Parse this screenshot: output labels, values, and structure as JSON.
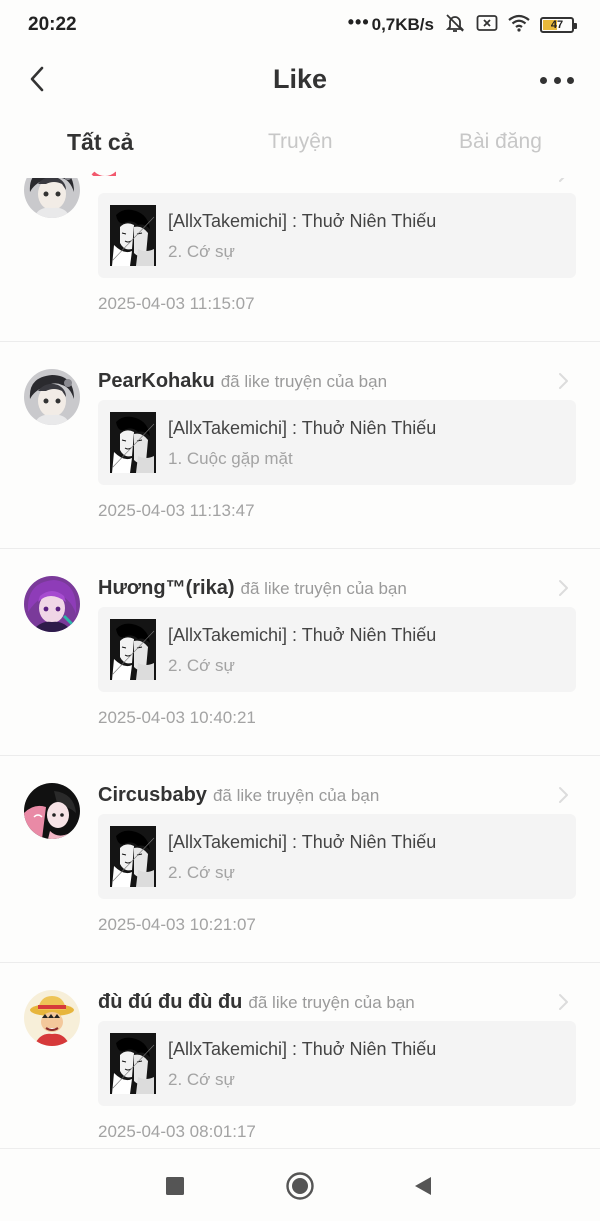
{
  "status_bar": {
    "time": "20:22",
    "dots": "•••",
    "net_speed": "0,7KB/s",
    "battery": "47",
    "icons": [
      "mute-icon",
      "sim-x-icon",
      "wifi-icon",
      "battery-icon"
    ]
  },
  "header": {
    "title": "Like",
    "back_icon": "chevron-left-icon",
    "more_icon": "more-dots-icon"
  },
  "tabs": [
    {
      "label": "Tất cả",
      "active": true
    },
    {
      "label": "Truyện",
      "active": false
    },
    {
      "label": "Bài đăng",
      "active": false
    }
  ],
  "colors": {
    "accent": "#f2596d",
    "card_bg": "#f4f4f4",
    "muted_text": "#a3a3a3"
  },
  "notifications": [
    {
      "username": "",
      "action": "",
      "avatar": "anime-dark-hair",
      "story_title": "[AllxTakemichi] : Thuở Niên Thiếu",
      "chapter": "2. Cớ sự",
      "time": "2025-04-03 11:15:07"
    },
    {
      "username": "PearKohaku",
      "action": "đã like truyện của bạn",
      "avatar": "anime-dark-hair",
      "story_title": "[AllxTakemichi] : Thuở Niên Thiếu",
      "chapter": "1. Cuộc gặp mặt",
      "time": "2025-04-03 11:13:47"
    },
    {
      "username": "Hương™(rika)",
      "action": "đã like truyện của bạn",
      "avatar": "anime-purple-hair",
      "story_title": "[AllxTakemichi] : Thuở Niên Thiếu",
      "chapter": "2. Cớ sự",
      "time": "2025-04-03 10:40:21"
    },
    {
      "username": "Circusbaby",
      "action": "đã like truyện của bạn",
      "avatar": "anime-pink-dark",
      "story_title": "[AllxTakemichi] : Thuở Niên Thiếu",
      "chapter": "2. Cớ sự",
      "time": "2025-04-03 10:21:07"
    },
    {
      "username": "đù đú đu đù đu",
      "action": "đã like truyện của bạn",
      "avatar": "straw-hat-character",
      "story_title": "[AllxTakemichi] : Thuở Niên Thiếu",
      "chapter": "2. Cớ sự",
      "time": "2025-04-03 08:01:17"
    }
  ],
  "nav_bar": {
    "icons": [
      "recents-square-icon",
      "home-circle-icon",
      "back-triangle-icon"
    ]
  }
}
